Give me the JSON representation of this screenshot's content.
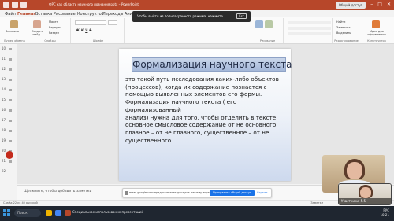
{
  "app": {
    "window_title": "ФРС как область научного познания.pptx – PowerPoint",
    "share_label": "Общий доступ",
    "accent_color": "#b7472a"
  },
  "menu": {
    "tabs": [
      "Файл",
      "Главная",
      "Вставка",
      "Рисование",
      "Конструктор",
      "Переходы",
      "Анимация"
    ]
  },
  "ribbon": {
    "groups": {
      "clipboard": "Буфер обмена",
      "slides": "Слайды",
      "font": "Шрифт",
      "paragraph": "Абзац",
      "drawing": "Рисование",
      "editing": "Редактирование",
      "designer": "Конструктор"
    },
    "paste": "Вставить",
    "new_slide": "Создать слайд",
    "layout": "Макет",
    "reset": "Вернуть",
    "section": "Раздел",
    "find": "Найти",
    "replace": "Заменить",
    "select": "Выделить",
    "design_ideas": "Идеи для оформления",
    "bold": "Ж",
    "italic": "К",
    "underline": "Ч",
    "strike": "S"
  },
  "toast": {
    "text": "Чтобы выйти из полноэкранного режима, нажмите",
    "key": "Esc"
  },
  "thumbnails": {
    "numbers": [
      "10",
      "11",
      "12",
      "13",
      "14",
      "15",
      "16",
      "17",
      "18",
      "19",
      "20",
      "21",
      "22"
    ]
  },
  "slide": {
    "title": "Формализация научного текста",
    "lines": [
      "это такой путь исследования каких-либо объектов",
      "(процессов), когда их содержание познается с",
      "помощью выявленных элементов его формы.",
      "Формализация научного текста ( его формализованный",
      "анализ) нужна для того,  чтобы отделить в тексте",
      "основное смысловое содержание от не основного,",
      "главное – от не главного, существенное – от не",
      "существенного."
    ]
  },
  "notes": {
    "placeholder": "Щелкните, чтобы добавить заметки"
  },
  "notification": {
    "text": "meet.google.com предоставляет доступ к вашему экрану.",
    "allow": "Прекратить общий доступ",
    "hide": "Скрыть"
  },
  "status": {
    "left": "Слайд 22 из 40   русский",
    "right": "Заметки"
  },
  "video": {
    "participant_label": "Участники: 5.5"
  },
  "taskbar": {
    "search": "Поиск",
    "active_window": "Специальное использование презентаций",
    "lang": "РУС",
    "time": "10:21"
  }
}
